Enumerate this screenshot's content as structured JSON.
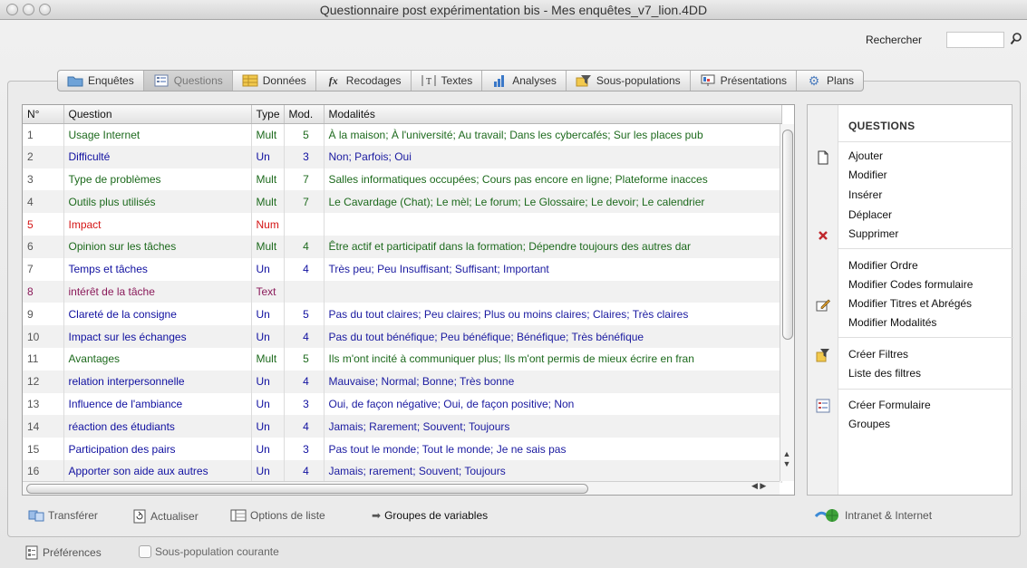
{
  "window": {
    "title": "Questionnaire post expérimentation bis - Mes enquêtes_v7_lion.4DD"
  },
  "search": {
    "label": "Rechercher",
    "value": ""
  },
  "tabs": [
    {
      "label": "Enquêtes",
      "icon": "folder-icon"
    },
    {
      "label": "Questions",
      "icon": "questions-form-icon"
    },
    {
      "label": "Données",
      "icon": "data-grid-icon"
    },
    {
      "label": "Recodages",
      "icon": "function-icon"
    },
    {
      "label": "Textes",
      "icon": "text-icon"
    },
    {
      "label": "Analyses",
      "icon": "bar-chart-icon"
    },
    {
      "label": "Sous-populations",
      "icon": "filter-icon"
    },
    {
      "label": "Présentations",
      "icon": "presentation-icon"
    },
    {
      "label": "Plans",
      "icon": "gear-icon"
    }
  ],
  "table": {
    "headers": {
      "num": "N°",
      "question": "Question",
      "type": "Type",
      "mod": "Mod.",
      "modalites": "Modalités"
    },
    "rows": [
      {
        "num": "1",
        "question": "Usage Internet",
        "type": "Mult",
        "mod": "5",
        "modalites": "À la maison; À l'université; Au travail; Dans les cybercafés; Sur les places pub"
      },
      {
        "num": "2",
        "question": "Difficulté",
        "type": "Un",
        "mod": "3",
        "modalites": "Non; Parfois; Oui"
      },
      {
        "num": "3",
        "question": "Type de problèmes",
        "type": "Mult",
        "mod": "7",
        "modalites": "Salles informatiques occupées; Cours pas encore en ligne; Plateforme inacces"
      },
      {
        "num": "4",
        "question": "Outils plus utilisés",
        "type": "Mult",
        "mod": "7",
        "modalites": "Le Cavardage (Chat); Le mèl; Le forum; Le Glossaire; Le devoir; Le calendrier"
      },
      {
        "num": "5",
        "question": "Impact",
        "type": "Num",
        "mod": "",
        "modalites": ""
      },
      {
        "num": "6",
        "question": "Opinion sur les tâches",
        "type": "Mult",
        "mod": "4",
        "modalites": "Être actif et participatif dans la formation; Dépendre toujours des autres dar"
      },
      {
        "num": "7",
        "question": "Temps et tâches",
        "type": "Un",
        "mod": "4",
        "modalites": "Très peu; Peu  Insuffisant; Suffisant; Important"
      },
      {
        "num": "8",
        "question": "intérêt de la tâche",
        "type": "Text",
        "mod": "",
        "modalites": ""
      },
      {
        "num": "9",
        "question": "Clareté de la consigne",
        "type": "Un",
        "mod": "5",
        "modalites": "Pas du tout claires; Peu claires; Plus ou moins claires; Claires; Très claires"
      },
      {
        "num": "10",
        "question": "Impact sur les échanges",
        "type": "Un",
        "mod": "4",
        "modalites": "Pas du tout bénéfique; Peu bénéfique; Bénéfique; Très bénéfique"
      },
      {
        "num": "11",
        "question": "Avantages",
        "type": "Mult",
        "mod": "5",
        "modalites": "Ils m'ont incité à communiquer plus; Ils m'ont permis de mieux écrire en fran"
      },
      {
        "num": "12",
        "question": "relation interpersonnelle",
        "type": "Un",
        "mod": "4",
        "modalites": "Mauvaise; Normal; Bonne; Très bonne"
      },
      {
        "num": "13",
        "question": "Influence de l'ambiance",
        "type": "Un",
        "mod": "3",
        "modalites": "Oui, de façon négative; Oui, de façon positive; Non"
      },
      {
        "num": "14",
        "question": "réaction des étudiants",
        "type": "Un",
        "mod": "4",
        "modalites": "Jamais; Rarement; Souvent; Toujours"
      },
      {
        "num": "15",
        "question": "Participation des pairs",
        "type": "Un",
        "mod": "3",
        "modalites": "Pas tout le monde; Tout le monde; Je ne sais pas"
      },
      {
        "num": "16",
        "question": "Apporter son aide aux autres",
        "type": "Un",
        "mod": "4",
        "modalites": "Jamais; rarement; Souvent; Toujours"
      }
    ]
  },
  "side_panel": {
    "title": "QUESTIONS",
    "ajouter": "Ajouter",
    "modifier": "Modifier",
    "inserer": "Insérer",
    "deplacer": "Déplacer",
    "supprimer": "Supprimer",
    "modifier_ordre": "Modifier Ordre",
    "modifier_codes": "Modifier Codes formulaire",
    "modifier_titres": "Modifier Titres et Abrégés",
    "modifier_modalites": "Modifier Modalités",
    "creer_filtres": "Créer Filtres",
    "liste_filtres": "Liste des filtres",
    "creer_formulaire": "Créer Formulaire",
    "groupes": "Groupes"
  },
  "bottom": {
    "transferer": "Transférer",
    "actualiser": "Actualiser",
    "options_liste": "Options de liste",
    "groupes_variables": "Groupes de variables",
    "intranet": "Intranet & Internet",
    "preferences": "Préférences",
    "sous_population": "Sous-population courante"
  },
  "colors": {
    "green": "#1d6a1d",
    "blue": "#1010a0",
    "red": "#d41414",
    "purple": "#8a1a5a"
  }
}
